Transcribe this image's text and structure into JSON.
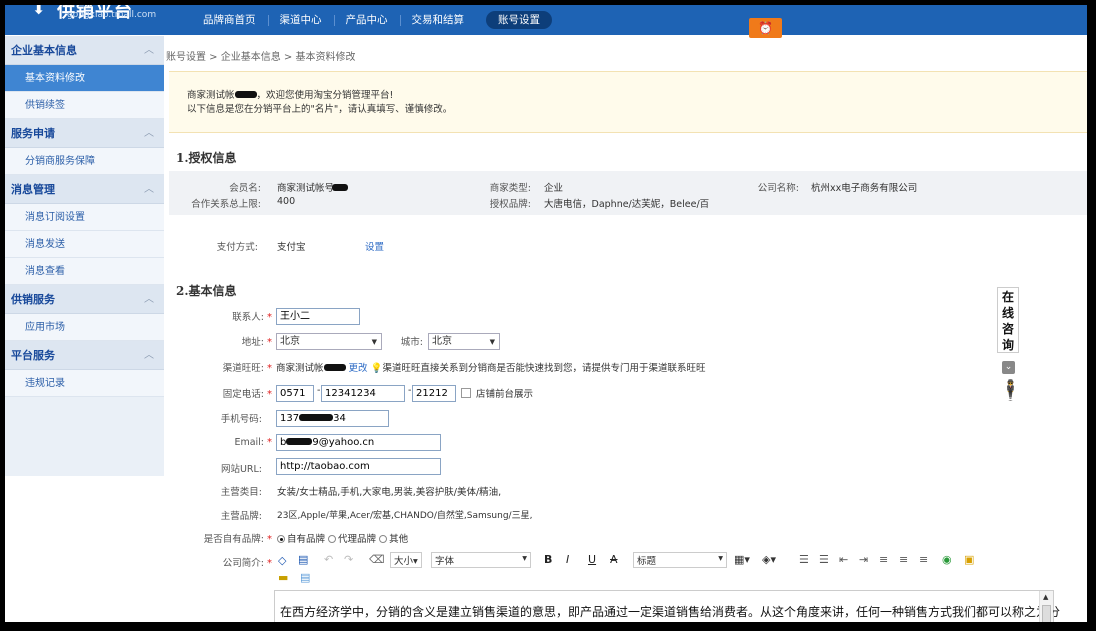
{
  "header": {
    "logo_text": "供销平台",
    "logo_sub": "gongxiao.tmall.com",
    "nav": [
      "品牌商首页",
      "渠道中心",
      "产品中心",
      "交易和结算",
      "账号设置"
    ],
    "active_index": 4,
    "accent": "#1e63b4"
  },
  "sidebar": {
    "groups": [
      {
        "title": "企业基本信息",
        "items": [
          "基本资料修改",
          "供销续签"
        ]
      },
      {
        "title": "服务申请",
        "items": [
          "分销商服务保障"
        ]
      },
      {
        "title": "消息管理",
        "items": [
          "消息订阅设置",
          "消息发送",
          "消息查看"
        ]
      },
      {
        "title": "供销服务",
        "items": [
          "应用市场"
        ]
      },
      {
        "title": "平台服务",
        "items": [
          "违规记录"
        ]
      }
    ]
  },
  "breadcrumb": "账号设置 > 企业基本信息 > 基本资料修改",
  "notice": {
    "line1_a": "商家测试帐",
    "line1_b": "，欢迎您使用淘宝分销管理平台!",
    "line2": "以下信息是您在分销平台上的\"名片\"，请认真填写、谨慎修改。"
  },
  "auth": {
    "title": "1.授权信息",
    "member_label": "会员名:",
    "member_value": "商家测试帐号",
    "max_label": "合作关系总上限:",
    "max_value": "400",
    "type_label": "商家类型:",
    "type_value": "企业",
    "brand_label": "授权品牌:",
    "brand_value": "大唐电信，Daphne/达芙妮，Belee/百",
    "company_label": "公司名称:",
    "company_value": "杭州xx电子商务有限公司",
    "pay_label": "支付方式:",
    "pay_value": "支付宝",
    "pay_link": "设置"
  },
  "basic": {
    "title": "2.基本信息",
    "contact_label": "联系人:",
    "contact_value": "王小二",
    "addr_label": "地址:",
    "addr_province": "北京",
    "city_label": "城市:",
    "addr_city": "北京",
    "ww_label": "渠道旺旺:",
    "ww_value": "商家测试帐",
    "ww_change": "更改",
    "ww_tip": "渠道旺旺直接关系到分销商是否能快速找到您，请提供专门用于渠道联系旺旺",
    "phone_label": "固定电话:",
    "phone_area": "0571",
    "phone_num": "12341234",
    "phone_ext": "21212",
    "phone_show": "店铺前台展示",
    "mobile_label": "手机号码:",
    "mobile_a": "137",
    "mobile_b": "34",
    "email_label": "Email:",
    "email_a": "b",
    "email_b": "9@yahoo.cn",
    "url_label": "网站URL:",
    "url_value": "http://taobao.com",
    "cat_label": "主营类目:",
    "cat_value": "女装/女士精品,手机,大家电,男装,美容护肤/美体/精油,",
    "mbrand_label": "主营品牌:",
    "mbrand_value": "23区,Apple/苹果,Acer/宏基,CHANDO/自然堂,Samsung/三星,",
    "own_label": "是否自有品牌:",
    "own_opts": [
      "自有品牌",
      "代理品牌",
      "其他"
    ],
    "own_selected": 0,
    "intro_label": "公司简介:",
    "editor": {
      "size": "大小",
      "font": "字体",
      "heading": "标题"
    },
    "intro_text": "在西方经济学中，分销的含义是建立销售渠道的意思，即产品通过一定渠道销售给消费者。从这个角度来讲，任何一种销售方式我们都可以称之为分"
  },
  "float": {
    "chars": [
      "在",
      "线",
      "咨",
      "询"
    ]
  }
}
